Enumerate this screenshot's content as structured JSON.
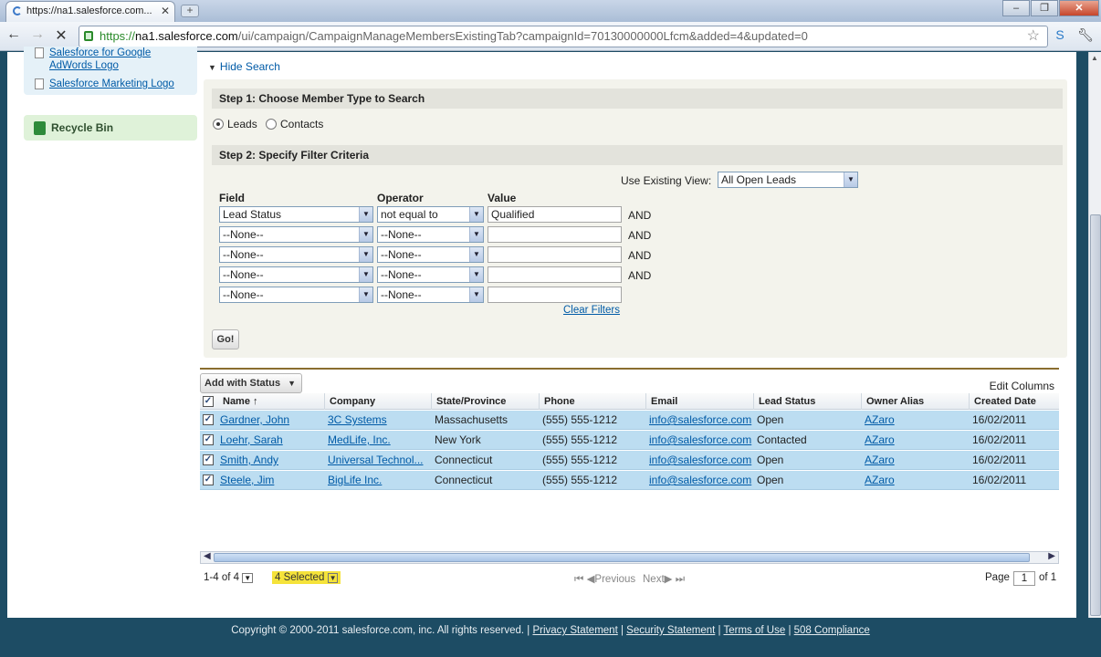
{
  "browser": {
    "tab_title": "https://na1.salesforce.com...",
    "url_prefix": "https://",
    "url_host": "na1.salesforce.com",
    "url_path": "/ui/campaign/CampaignManageMembersExistingTab?campaignId=70130000000Lfcm&added=4&updated=0"
  },
  "sidebar": {
    "links": [
      "Salesforce for Google AdWords Logo",
      "Salesforce Marketing Logo"
    ],
    "recycle_bin": "Recycle Bin"
  },
  "search": {
    "hide_label": "Hide Search",
    "step1_title": "Step 1: Choose Member Type to Search",
    "member_types": [
      "Leads",
      "Contacts"
    ],
    "selected_type": "Leads",
    "step2_title": "Step 2: Specify Filter Criteria",
    "existing_view_label": "Use Existing View:",
    "existing_view_value": "All Open Leads",
    "col_field": "Field",
    "col_operator": "Operator",
    "col_value": "Value",
    "filters": [
      {
        "field": "Lead Status",
        "operator": "not equal to",
        "value": "Qualified",
        "joiner": "AND"
      },
      {
        "field": "--None--",
        "operator": "--None--",
        "value": "",
        "joiner": "AND"
      },
      {
        "field": "--None--",
        "operator": "--None--",
        "value": "",
        "joiner": "AND"
      },
      {
        "field": "--None--",
        "operator": "--None--",
        "value": "",
        "joiner": "AND"
      },
      {
        "field": "--None--",
        "operator": "--None--",
        "value": "",
        "joiner": ""
      }
    ],
    "clear_filters": "Clear Filters",
    "go_button": "Go!"
  },
  "results": {
    "add_with_status": "Add with Status",
    "edit_columns": "Edit Columns",
    "columns": [
      "Name ↑",
      "Company",
      "State/Province",
      "Phone",
      "Email",
      "Lead Status",
      "Owner Alias",
      "Created Date"
    ],
    "rows": [
      {
        "name": "Gardner, John",
        "company": "3C Systems",
        "state": "Massachusetts",
        "phone": "(555) 555-1212",
        "email": "info@salesforce.com",
        "status": "Open",
        "owner": "AZaro",
        "created": "16/02/2011"
      },
      {
        "name": "Loehr, Sarah",
        "company": "MedLife, Inc.",
        "state": "New York",
        "phone": "(555) 555-1212",
        "email": "info@salesforce.com",
        "status": "Contacted",
        "owner": "AZaro",
        "created": "16/02/2011"
      },
      {
        "name": "Smith, Andy",
        "company": "Universal Technol...",
        "state": "Connecticut",
        "phone": "(555) 555-1212",
        "email": "info@salesforce.com",
        "status": "Open",
        "owner": "AZaro",
        "created": "16/02/2011"
      },
      {
        "name": "Steele, Jim",
        "company": "BigLife Inc.",
        "state": "Connecticut",
        "phone": "(555) 555-1212",
        "email": "info@salesforce.com",
        "status": "Open",
        "owner": "AZaro",
        "created": "16/02/2011"
      }
    ],
    "range": "1-4 of 4",
    "selected": "4 Selected",
    "previous": "Previous",
    "next": "Next",
    "page_label": "Page",
    "page_value": "1",
    "page_of": "of 1"
  },
  "footer": {
    "copyright": "Copyright © 2000-2011 salesforce.com, inc. All rights reserved. |",
    "links": [
      "Privacy Statement",
      "Security Statement",
      "Terms of Use",
      "508 Compliance"
    ]
  }
}
